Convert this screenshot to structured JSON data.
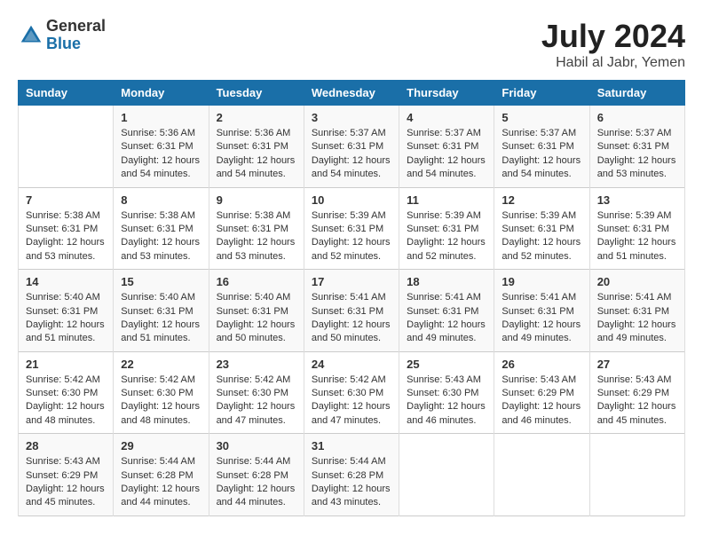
{
  "logo": {
    "general": "General",
    "blue": "Blue"
  },
  "title": {
    "month_year": "July 2024",
    "location": "Habil al Jabr, Yemen"
  },
  "header": {
    "days": [
      "Sunday",
      "Monday",
      "Tuesday",
      "Wednesday",
      "Thursday",
      "Friday",
      "Saturday"
    ]
  },
  "weeks": [
    [
      {
        "num": "",
        "info": ""
      },
      {
        "num": "1",
        "info": "Sunrise: 5:36 AM\nSunset: 6:31 PM\nDaylight: 12 hours\nand 54 minutes."
      },
      {
        "num": "2",
        "info": "Sunrise: 5:36 AM\nSunset: 6:31 PM\nDaylight: 12 hours\nand 54 minutes."
      },
      {
        "num": "3",
        "info": "Sunrise: 5:37 AM\nSunset: 6:31 PM\nDaylight: 12 hours\nand 54 minutes."
      },
      {
        "num": "4",
        "info": "Sunrise: 5:37 AM\nSunset: 6:31 PM\nDaylight: 12 hours\nand 54 minutes."
      },
      {
        "num": "5",
        "info": "Sunrise: 5:37 AM\nSunset: 6:31 PM\nDaylight: 12 hours\nand 54 minutes."
      },
      {
        "num": "6",
        "info": "Sunrise: 5:37 AM\nSunset: 6:31 PM\nDaylight: 12 hours\nand 53 minutes."
      }
    ],
    [
      {
        "num": "7",
        "info": "Sunrise: 5:38 AM\nSunset: 6:31 PM\nDaylight: 12 hours\nand 53 minutes."
      },
      {
        "num": "8",
        "info": "Sunrise: 5:38 AM\nSunset: 6:31 PM\nDaylight: 12 hours\nand 53 minutes."
      },
      {
        "num": "9",
        "info": "Sunrise: 5:38 AM\nSunset: 6:31 PM\nDaylight: 12 hours\nand 53 minutes."
      },
      {
        "num": "10",
        "info": "Sunrise: 5:39 AM\nSunset: 6:31 PM\nDaylight: 12 hours\nand 52 minutes."
      },
      {
        "num": "11",
        "info": "Sunrise: 5:39 AM\nSunset: 6:31 PM\nDaylight: 12 hours\nand 52 minutes."
      },
      {
        "num": "12",
        "info": "Sunrise: 5:39 AM\nSunset: 6:31 PM\nDaylight: 12 hours\nand 52 minutes."
      },
      {
        "num": "13",
        "info": "Sunrise: 5:39 AM\nSunset: 6:31 PM\nDaylight: 12 hours\nand 51 minutes."
      }
    ],
    [
      {
        "num": "14",
        "info": "Sunrise: 5:40 AM\nSunset: 6:31 PM\nDaylight: 12 hours\nand 51 minutes."
      },
      {
        "num": "15",
        "info": "Sunrise: 5:40 AM\nSunset: 6:31 PM\nDaylight: 12 hours\nand 51 minutes."
      },
      {
        "num": "16",
        "info": "Sunrise: 5:40 AM\nSunset: 6:31 PM\nDaylight: 12 hours\nand 50 minutes."
      },
      {
        "num": "17",
        "info": "Sunrise: 5:41 AM\nSunset: 6:31 PM\nDaylight: 12 hours\nand 50 minutes."
      },
      {
        "num": "18",
        "info": "Sunrise: 5:41 AM\nSunset: 6:31 PM\nDaylight: 12 hours\nand 49 minutes."
      },
      {
        "num": "19",
        "info": "Sunrise: 5:41 AM\nSunset: 6:31 PM\nDaylight: 12 hours\nand 49 minutes."
      },
      {
        "num": "20",
        "info": "Sunrise: 5:41 AM\nSunset: 6:31 PM\nDaylight: 12 hours\nand 49 minutes."
      }
    ],
    [
      {
        "num": "21",
        "info": "Sunrise: 5:42 AM\nSunset: 6:30 PM\nDaylight: 12 hours\nand 48 minutes."
      },
      {
        "num": "22",
        "info": "Sunrise: 5:42 AM\nSunset: 6:30 PM\nDaylight: 12 hours\nand 48 minutes."
      },
      {
        "num": "23",
        "info": "Sunrise: 5:42 AM\nSunset: 6:30 PM\nDaylight: 12 hours\nand 47 minutes."
      },
      {
        "num": "24",
        "info": "Sunrise: 5:42 AM\nSunset: 6:30 PM\nDaylight: 12 hours\nand 47 minutes."
      },
      {
        "num": "25",
        "info": "Sunrise: 5:43 AM\nSunset: 6:30 PM\nDaylight: 12 hours\nand 46 minutes."
      },
      {
        "num": "26",
        "info": "Sunrise: 5:43 AM\nSunset: 6:29 PM\nDaylight: 12 hours\nand 46 minutes."
      },
      {
        "num": "27",
        "info": "Sunrise: 5:43 AM\nSunset: 6:29 PM\nDaylight: 12 hours\nand 45 minutes."
      }
    ],
    [
      {
        "num": "28",
        "info": "Sunrise: 5:43 AM\nSunset: 6:29 PM\nDaylight: 12 hours\nand 45 minutes."
      },
      {
        "num": "29",
        "info": "Sunrise: 5:44 AM\nSunset: 6:28 PM\nDaylight: 12 hours\nand 44 minutes."
      },
      {
        "num": "30",
        "info": "Sunrise: 5:44 AM\nSunset: 6:28 PM\nDaylight: 12 hours\nand 44 minutes."
      },
      {
        "num": "31",
        "info": "Sunrise: 5:44 AM\nSunset: 6:28 PM\nDaylight: 12 hours\nand 43 minutes."
      },
      {
        "num": "",
        "info": ""
      },
      {
        "num": "",
        "info": ""
      },
      {
        "num": "",
        "info": ""
      }
    ]
  ]
}
